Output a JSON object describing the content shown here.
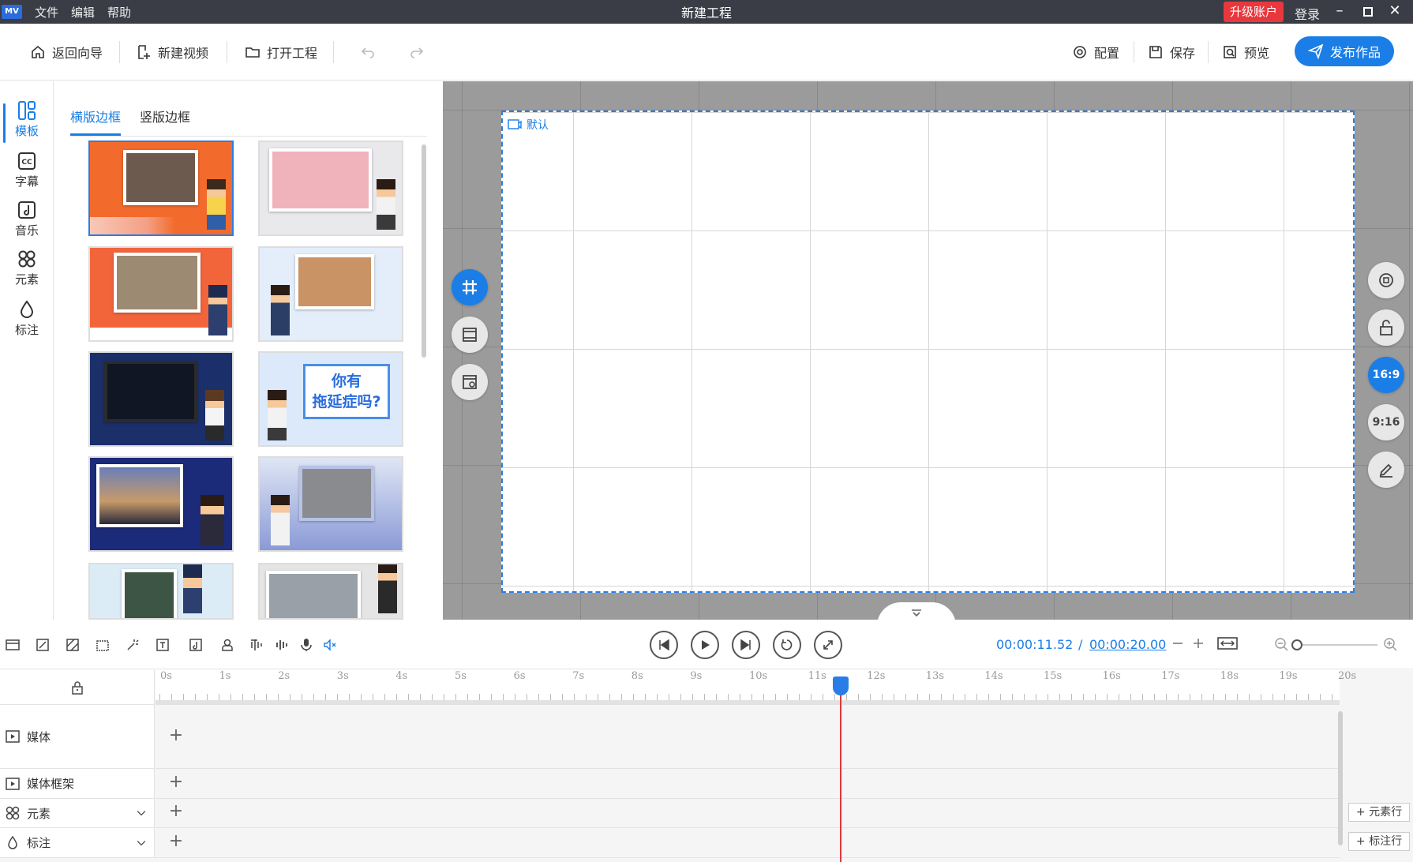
{
  "titlebar": {
    "logo": "MV",
    "menus": [
      "文件",
      "编辑",
      "帮助"
    ],
    "window_title": "新建工程",
    "upgrade": "升级账户",
    "login": "登录"
  },
  "toolbar": {
    "back": "返回向导",
    "new_video": "新建视频",
    "open_project": "打开工程",
    "settings": "配置",
    "save": "保存",
    "preview": "预览",
    "publish": "发布作品"
  },
  "leftnav": {
    "items": [
      {
        "label": "模板",
        "icon": "template-icon"
      },
      {
        "label": "字幕",
        "icon": "cc-icon"
      },
      {
        "label": "音乐",
        "icon": "music-icon"
      },
      {
        "label": "元素",
        "icon": "elements-icon"
      },
      {
        "label": "标注",
        "icon": "drop-icon"
      }
    ]
  },
  "panel": {
    "tabs": [
      "横版边框",
      "竖版边框"
    ],
    "thumb_text": "你有\n拖延症吗?"
  },
  "stage": {
    "canvas_label": "默认",
    "ratio_169": "16:9",
    "ratio_916": "9:16"
  },
  "playback": {
    "current_time": "00:00:11.52",
    "separator": "/",
    "total_time": "00:00:20.00"
  },
  "timeline": {
    "ruler": [
      "0s",
      "1s",
      "2s",
      "3s",
      "4s",
      "5s",
      "6s",
      "7s",
      "8s",
      "9s",
      "10s",
      "11s",
      "12s",
      "13s",
      "14s",
      "15s",
      "16s",
      "17s",
      "18s",
      "19s",
      "20s"
    ],
    "tracks": [
      {
        "label": "媒体",
        "icon": "media-icon"
      },
      {
        "label": "媒体框架",
        "icon": "media-frame-icon"
      },
      {
        "label": "元素",
        "icon": "elements-icon"
      },
      {
        "label": "标注",
        "icon": "drop-icon"
      }
    ],
    "add_element_row": "元素行",
    "add_annotation_row": "标注行"
  },
  "colors": {
    "accent": "#1a7ee6",
    "titlebar": "#3a3d45",
    "upgrade": "#e8383d",
    "playhead": "#e0383d"
  }
}
